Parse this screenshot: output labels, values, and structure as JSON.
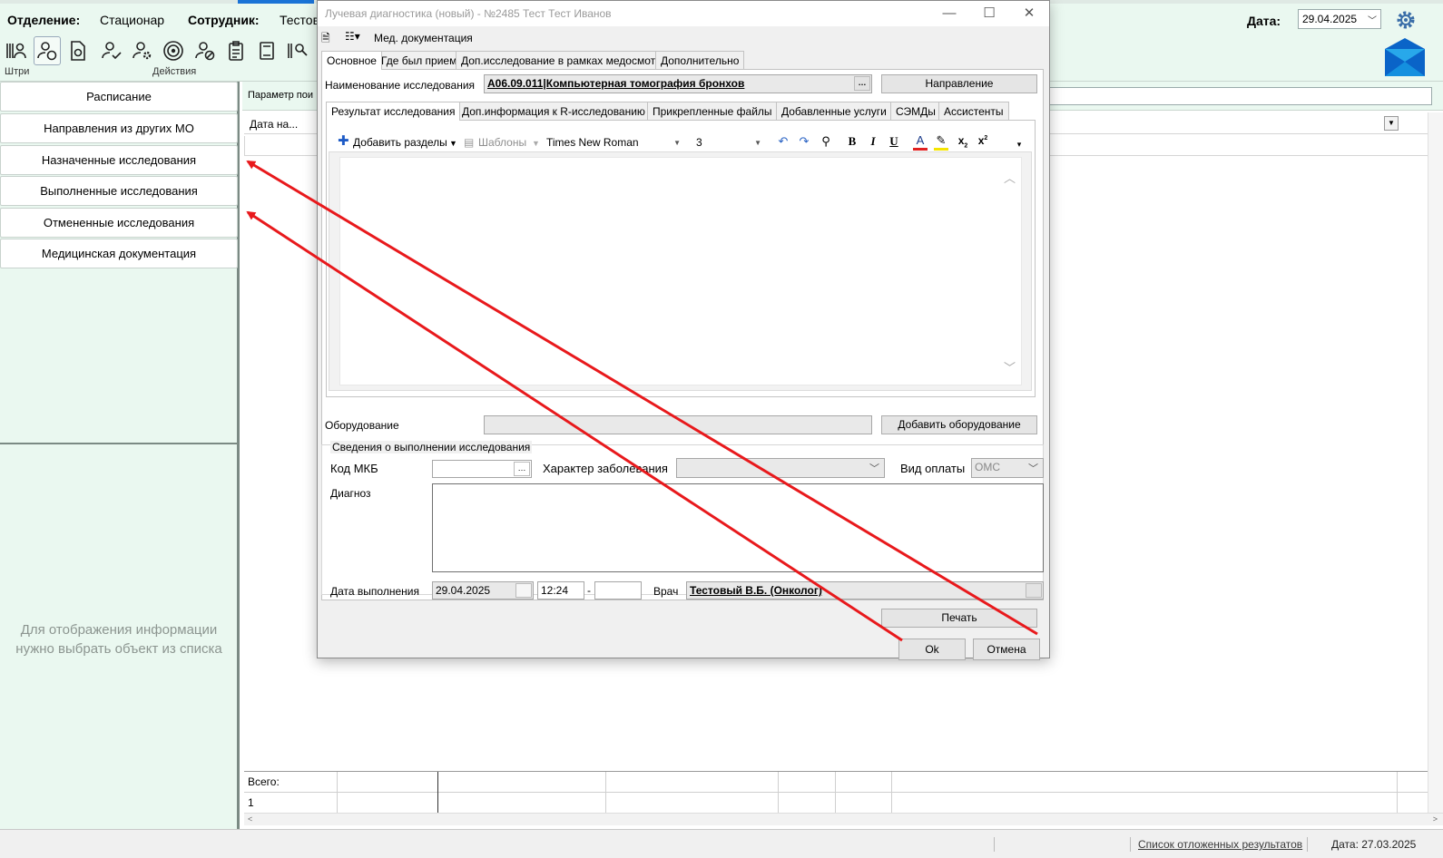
{
  "app": {
    "department_label": "Отделение:",
    "department_value": "Стационар",
    "employee_label": "Сотрудник:",
    "employee_value": "Тестов",
    "toolbar_caption_left": "Штри",
    "toolbar_caption_actions": "Действия",
    "date_label": "Дата:",
    "date_value": "29.04.2025",
    "icons": [
      "barcode-person-icon",
      "person-sync-icon",
      "document-sync-icon",
      "person-check-icon",
      "person-settings-icon",
      "target-icon",
      "person-cancel-icon",
      "clipboard-icon",
      "book-icon",
      "person-search-icon"
    ]
  },
  "sidebar": {
    "items": [
      {
        "label": "Расписание"
      },
      {
        "label": "Направления из других МО"
      },
      {
        "label": "Назначенные исследования"
      },
      {
        "label": "Выполненные исследования"
      },
      {
        "label": "Отмененные исследования"
      },
      {
        "label": "Медицинская документация"
      }
    ],
    "hint_line1": "Для отображения информации",
    "hint_line2": "нужно выбрать объект из списка"
  },
  "main": {
    "param_label": "Параметр пои",
    "column1": "Дата на...",
    "totals_label": "Всего:",
    "totals_count": "1"
  },
  "status_bar": {
    "deferred_link": "Список отложенных результатов",
    "date": "Дата: 27.03.2025"
  },
  "dialog": {
    "title": "Лучевая диагностика (новый) - №2485 Тест Тест Иванов",
    "window_buttons": {
      "minimize": "—",
      "maximize": "☐",
      "close": "✕"
    },
    "toolbar_label": "Мед. документация",
    "top_tabs": [
      "Основное",
      "Где был прием",
      "Доп.исследование в рамках медосмотра",
      "Дополнительно"
    ],
    "study_name_label": "Наименование исследования",
    "study_name_value": "A06.09.011|Компьютерная томография бронхов",
    "direction_button": "Направление",
    "inner_tabs": [
      "Результат исследования",
      "Доп.информация к R-исследованию",
      "Прикрепленные файлы",
      "Добавленные услуги",
      "СЭМДы",
      "Ассистенты"
    ],
    "editor": {
      "add_sections": "Добавить разделы",
      "templates": "Шаблоны",
      "font": "Times New Roman",
      "size": "3"
    },
    "equipment_label": "Оборудование",
    "add_equipment_button": "Добавить оборудование",
    "group_title": "Сведения о выполнении исследования",
    "mkb_label": "Код МКБ",
    "disease_label": "Характер заболевания",
    "payment_label": "Вид оплаты",
    "payment_value": "ОМС",
    "diagnosis_label": "Диагноз",
    "exec_date_label": "Дата выполнения",
    "exec_date_value": "29.04.2025",
    "time_value": "12:24",
    "time_dash": "-",
    "doctor_label": "Врач",
    "doctor_value": "Тестовый В.Б. (Онколог)",
    "print_button": "Печать",
    "ok_button": "Ok",
    "cancel_button": "Отмена"
  },
  "colors": {
    "app_background": "#eaf8f0",
    "annotation_arrow": "#e8191c",
    "accent_blue": "#1a73d6"
  }
}
